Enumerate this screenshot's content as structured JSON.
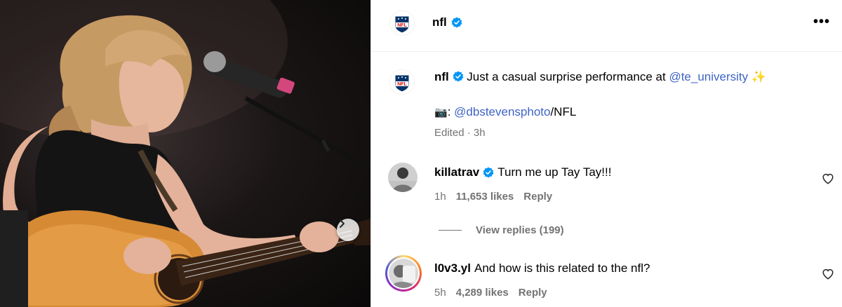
{
  "post": {
    "author": "nfl",
    "caption_user": "nfl",
    "caption_text": "Just a casual surprise performance at",
    "caption_mention": "@te_university",
    "caption_sparkle": "✨",
    "caption_line2_icon": "📷",
    "caption_line2_prefix": ":",
    "caption_line2_mention": "@dbstevensphoto",
    "caption_line2_suffix": "/NFL",
    "edited": "Edited · 3h",
    "more_label": "•••"
  },
  "comments": [
    {
      "user": "killatrav",
      "verified": true,
      "text": "Turn me up Tay Tay!!!",
      "time": "1h",
      "likes": "11,653 likes",
      "reply_label": "Reply",
      "view_replies": "View replies (199)"
    },
    {
      "user": "l0v3.yl",
      "verified": false,
      "text": "And how is this related to the nfl?",
      "time": "5h",
      "likes": "4,289 likes",
      "reply_label": "Reply"
    }
  ],
  "colors": {
    "link": "#3f64c4",
    "verified": "#0095f6",
    "muted": "#737373",
    "nfl_blue": "#013369",
    "nfl_red": "#d50a0a"
  },
  "icons": [
    "verified-badge-icon",
    "more-options-icon",
    "heart-icon",
    "next-arrow-icon",
    "camera-emoji",
    "sparkles-emoji"
  ]
}
